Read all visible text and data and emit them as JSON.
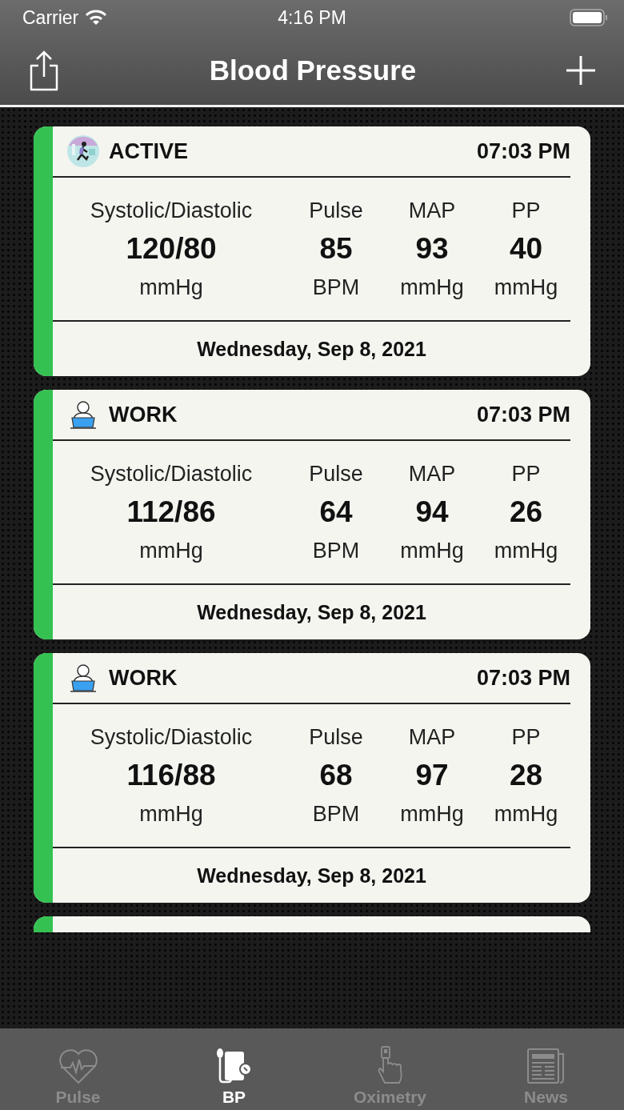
{
  "status_bar": {
    "carrier": "Carrier",
    "time": "4:16 PM"
  },
  "nav_bar": {
    "title": "Blood Pressure"
  },
  "cards": [
    {
      "kind": "active",
      "category": "ACTIVE",
      "time": "07:03 PM",
      "columns": [
        {
          "label": "Systolic/Diastolic",
          "value": "120/80",
          "unit": "mmHg"
        },
        {
          "label": "Pulse",
          "value": "85",
          "unit": "BPM"
        },
        {
          "label": "MAP",
          "value": "93",
          "unit": "mmHg"
        },
        {
          "label": "PP",
          "value": "40",
          "unit": "mmHg"
        }
      ],
      "date": "Wednesday, Sep 8, 2021"
    },
    {
      "kind": "work",
      "category": "WORK",
      "time": "07:03 PM",
      "columns": [
        {
          "label": "Systolic/Diastolic",
          "value": "112/86",
          "unit": "mmHg"
        },
        {
          "label": "Pulse",
          "value": "64",
          "unit": "BPM"
        },
        {
          "label": "MAP",
          "value": "94",
          "unit": "mmHg"
        },
        {
          "label": "PP",
          "value": "26",
          "unit": "mmHg"
        }
      ],
      "date": "Wednesday, Sep 8, 2021"
    },
    {
      "kind": "work",
      "category": "WORK",
      "time": "07:03 PM",
      "columns": [
        {
          "label": "Systolic/Diastolic",
          "value": "116/88",
          "unit": "mmHg"
        },
        {
          "label": "Pulse",
          "value": "68",
          "unit": "BPM"
        },
        {
          "label": "MAP",
          "value": "97",
          "unit": "mmHg"
        },
        {
          "label": "PP",
          "value": "28",
          "unit": "mmHg"
        }
      ],
      "date": "Wednesday, Sep 8, 2021"
    }
  ],
  "more_cards_below": true,
  "tab_bar": [
    {
      "kind": "pulse",
      "label": "Pulse",
      "selected": false
    },
    {
      "kind": "bp",
      "label": "BP",
      "selected": true
    },
    {
      "kind": "oximetry",
      "label": "Oximetry",
      "selected": false
    },
    {
      "kind": "news",
      "label": "News",
      "selected": false
    }
  ]
}
